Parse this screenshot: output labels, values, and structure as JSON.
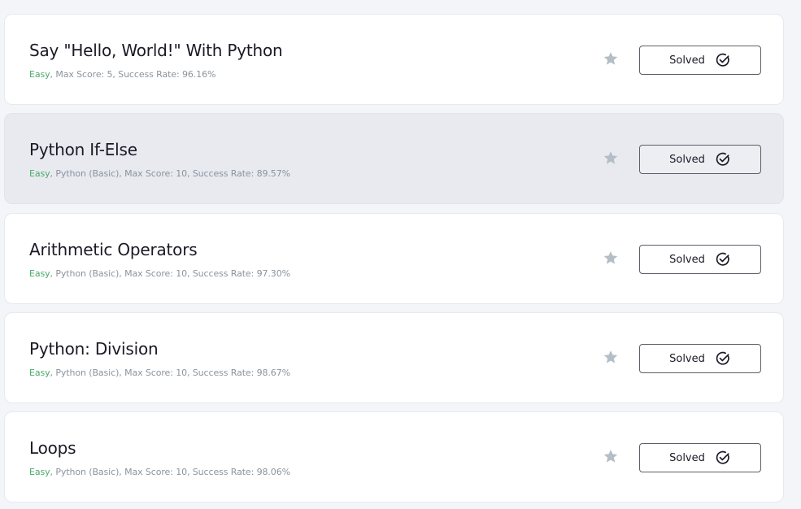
{
  "colors": {
    "page_background": "#f3f5f9",
    "card_background": "#ffffff",
    "card_hover_background": "#e8eaf0",
    "difficulty_easy": "#4aab6a",
    "meta_text": "#8a949d",
    "star": "#b3bec6"
  },
  "challenges": [
    {
      "title": "Say \"Hello, World!\" With Python",
      "difficulty": "Easy",
      "details": ", Max Score: 5, Success Rate: 96.16%",
      "status_label": "Solved",
      "status_icon": "check-circle-icon",
      "bookmark_icon": "star-icon"
    },
    {
      "title": "Python If-Else",
      "difficulty": "Easy",
      "details": ", Python (Basic), Max Score: 10, Success Rate: 89.57%",
      "status_label": "Solved",
      "status_icon": "check-circle-icon",
      "bookmark_icon": "star-icon"
    },
    {
      "title": "Arithmetic Operators",
      "difficulty": "Easy",
      "details": ", Python (Basic), Max Score: 10, Success Rate: 97.30%",
      "status_label": "Solved",
      "status_icon": "check-circle-icon",
      "bookmark_icon": "star-icon"
    },
    {
      "title": "Python: Division",
      "difficulty": "Easy",
      "details": ", Python (Basic), Max Score: 10, Success Rate: 98.67%",
      "status_label": "Solved",
      "status_icon": "check-circle-icon",
      "bookmark_icon": "star-icon"
    },
    {
      "title": "Loops",
      "difficulty": "Easy",
      "details": ", Python (Basic), Max Score: 10, Success Rate: 98.06%",
      "status_label": "Solved",
      "status_icon": "check-circle-icon",
      "bookmark_icon": "star-icon"
    }
  ]
}
